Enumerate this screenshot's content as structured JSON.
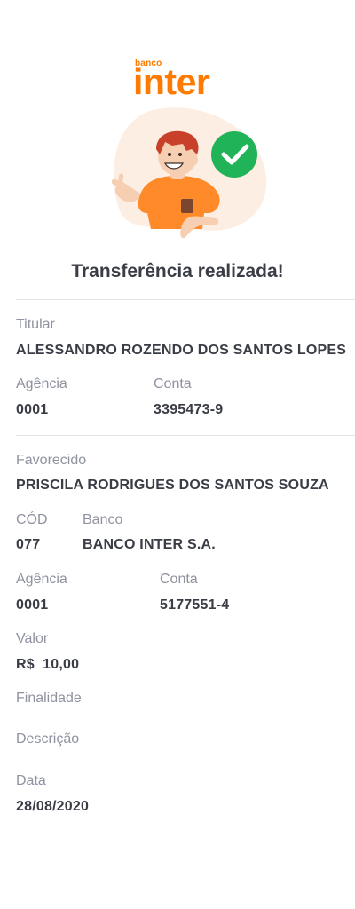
{
  "brand": {
    "small": "banco",
    "name": "inter"
  },
  "title": "Transferência realizada!",
  "titular": {
    "label": "Titular",
    "name": "ALESSANDRO ROZENDO DOS SANTOS LOPES",
    "agencia_label": "Agência",
    "agencia": "0001",
    "conta_label": "Conta",
    "conta": "3395473-9"
  },
  "favorecido": {
    "label": "Favorecido",
    "name": "PRISCILA RODRIGUES DOS SANTOS SOUZA",
    "cod_label": "CÓD",
    "cod": "077",
    "banco_label": "Banco",
    "banco": "BANCO INTER S.A.",
    "agencia_label": "Agência",
    "agencia": "0001",
    "conta_label": "Conta",
    "conta": "5177551-4"
  },
  "valor": {
    "label": "Valor",
    "value": "R$  10,00"
  },
  "finalidade": {
    "label": "Finalidade"
  },
  "descricao": {
    "label": "Descrição"
  },
  "data": {
    "label": "Data",
    "value": "28/08/2020"
  },
  "colors": {
    "brand": "#ff7a00",
    "success": "#21b357",
    "shirt": "#ff8a2a"
  },
  "icons": {
    "success": "check-icon"
  }
}
